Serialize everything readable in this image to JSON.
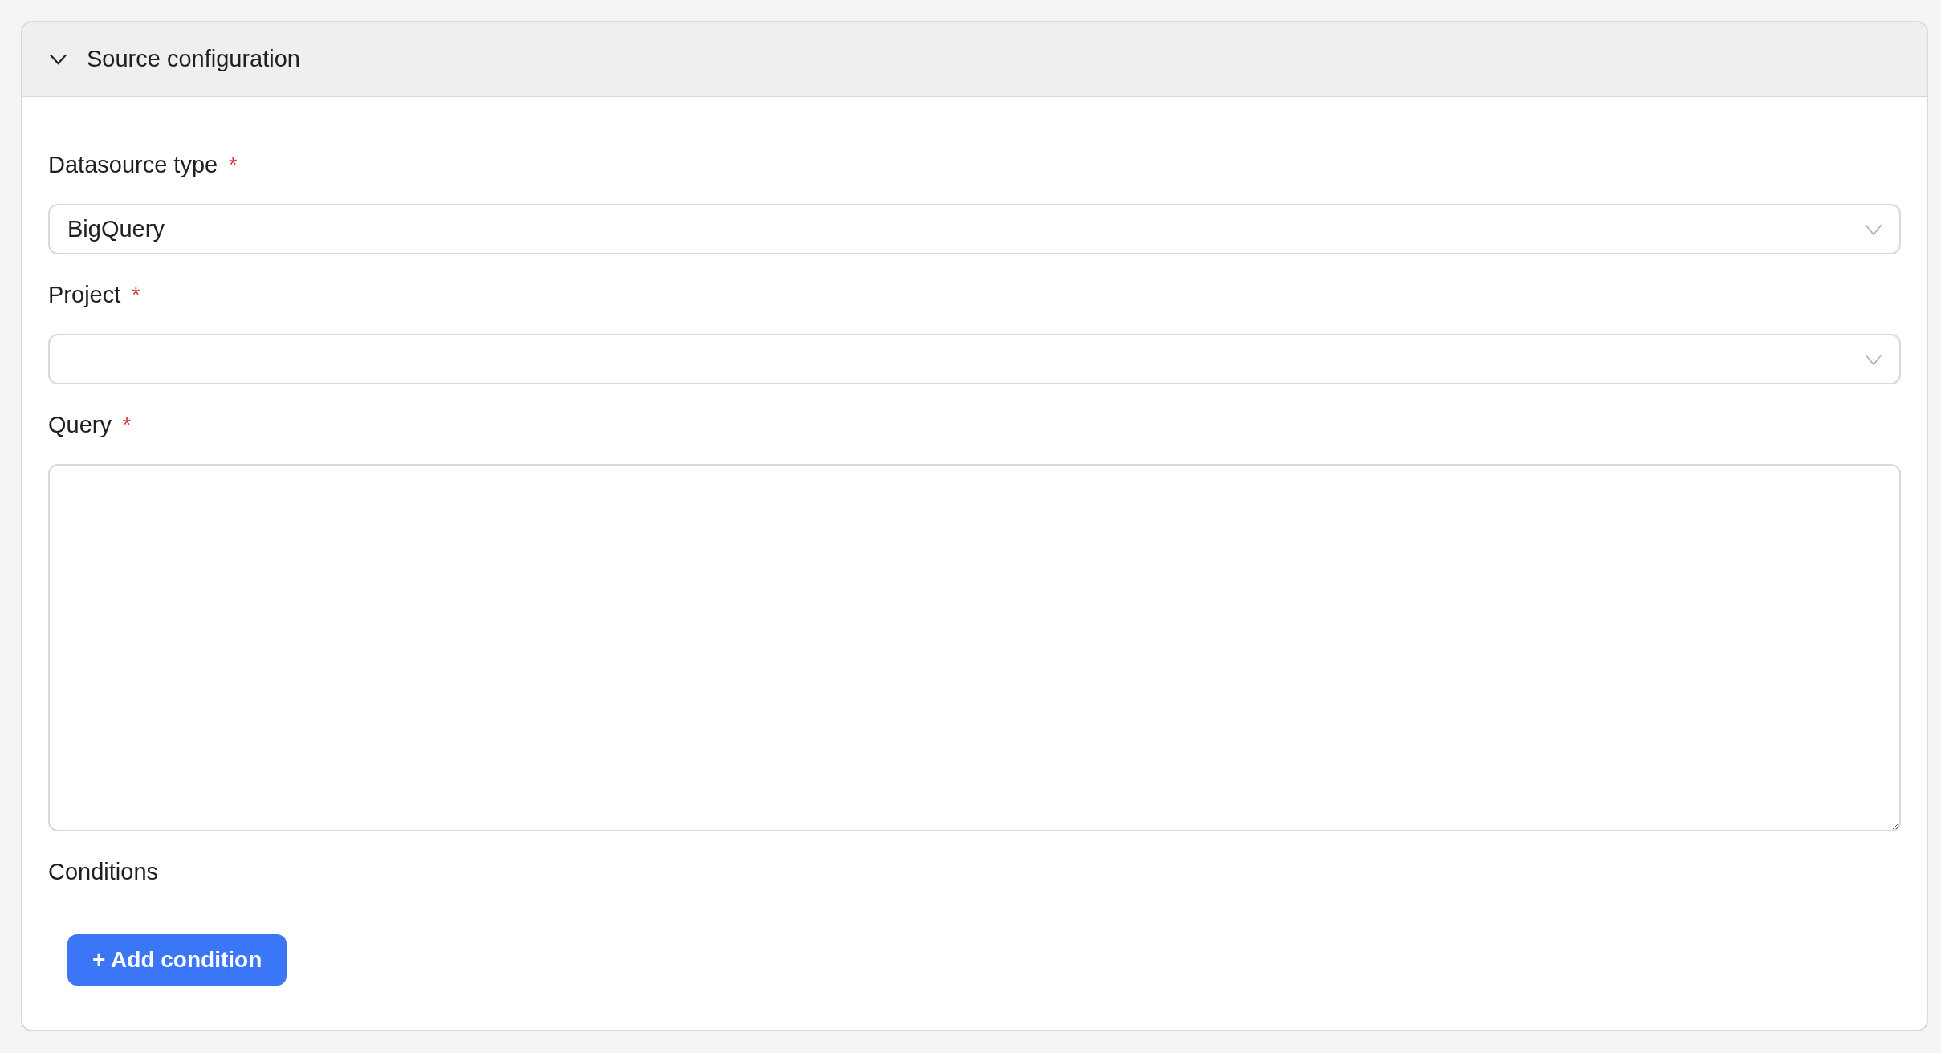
{
  "panel": {
    "title": "Source configuration",
    "expanded": true,
    "fields": [
      {
        "kind": "select",
        "label": "Datasource type",
        "required_mark": "*",
        "value": "BigQuery"
      },
      {
        "kind": "select",
        "label": "Project",
        "required_mark": "*"
      },
      {
        "kind": "textarea",
        "label": "Query",
        "required_mark": "*"
      }
    ],
    "conditions": {
      "label": "Conditions",
      "add_button": "+ Add condition"
    }
  }
}
